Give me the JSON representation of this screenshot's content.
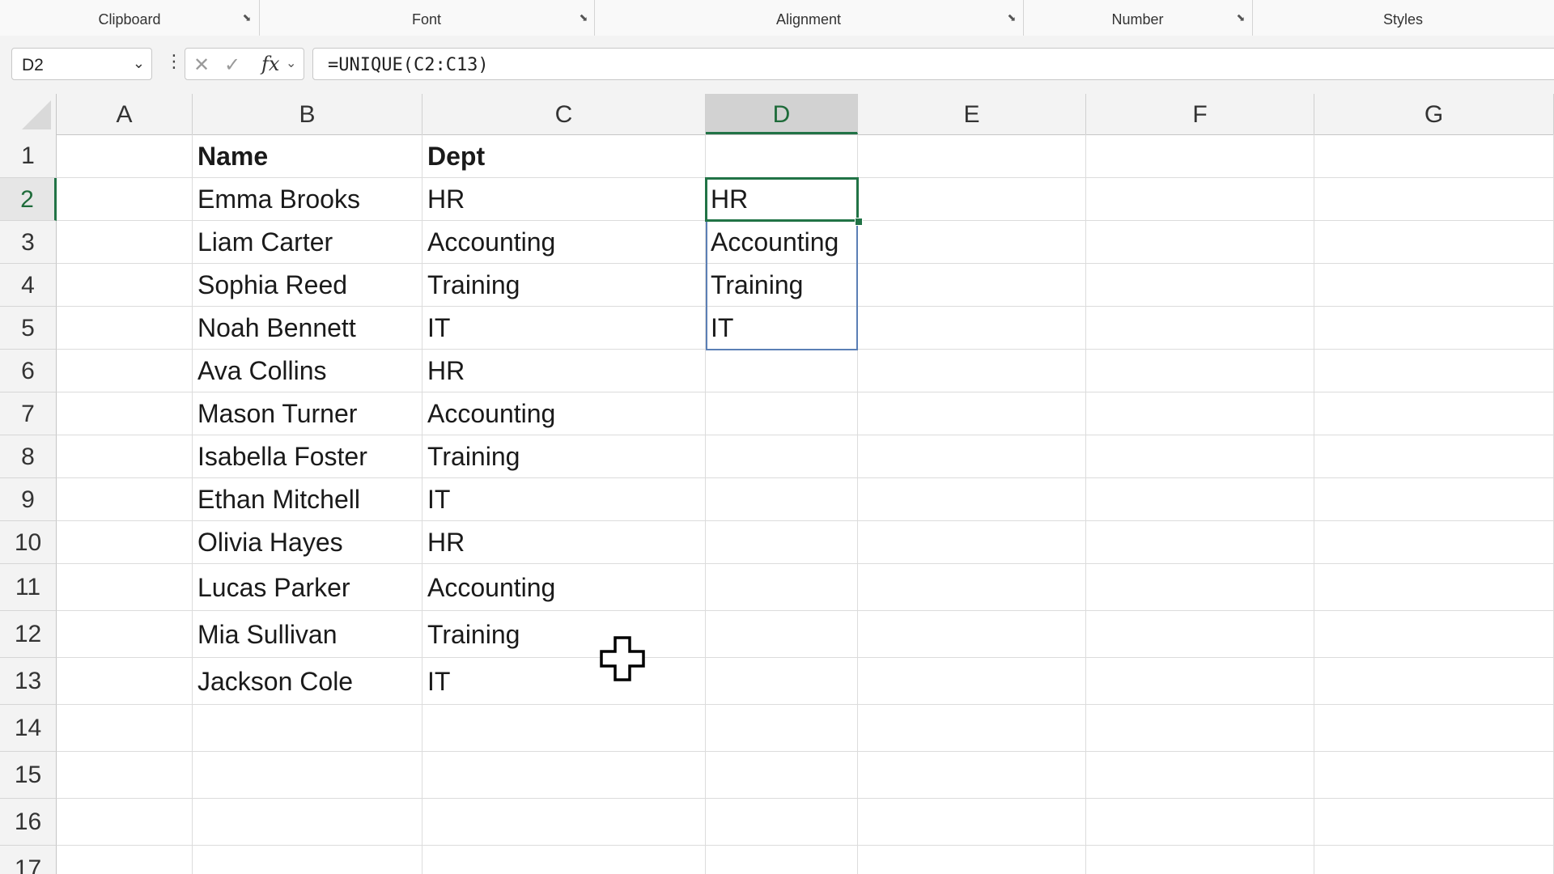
{
  "ribbon": {
    "groups": [
      {
        "label": "Clipboard",
        "has_launcher": true
      },
      {
        "label": "Font",
        "has_launcher": true
      },
      {
        "label": "Alignment",
        "has_launcher": true
      },
      {
        "label": "Number",
        "has_launcher": true
      },
      {
        "label": "Styles",
        "has_launcher": false
      }
    ]
  },
  "formula_bar": {
    "name_box": "D2",
    "formula": "=UNIQUE(C2:C13)",
    "fx_label": "fx"
  },
  "sheet": {
    "columns": [
      "A",
      "B",
      "C",
      "D",
      "E",
      "F",
      "G"
    ],
    "active_column": "D",
    "active_row": "2",
    "rows": [
      {
        "num": "1",
        "B": "Name",
        "C": "Dept",
        "D": ""
      },
      {
        "num": "2",
        "B": "Emma Brooks",
        "C": "HR",
        "D": "HR"
      },
      {
        "num": "3",
        "B": "Liam Carter",
        "C": "Accounting",
        "D": "Accounting"
      },
      {
        "num": "4",
        "B": "Sophia Reed",
        "C": "Training",
        "D": "Training"
      },
      {
        "num": "5",
        "B": "Noah Bennett",
        "C": "IT",
        "D": "IT"
      },
      {
        "num": "6",
        "B": "Ava Collins",
        "C": "HR",
        "D": ""
      },
      {
        "num": "7",
        "B": "Mason Turner",
        "C": "Accounting",
        "D": ""
      },
      {
        "num": "8",
        "B": "Isabella Foster",
        "C": "Training",
        "D": ""
      },
      {
        "num": "9",
        "B": "Ethan Mitchell",
        "C": "IT",
        "D": ""
      },
      {
        "num": "10",
        "B": "Olivia Hayes",
        "C": "HR",
        "D": ""
      },
      {
        "num": "11",
        "B": "Lucas Parker",
        "C": "Accounting",
        "D": ""
      },
      {
        "num": "12",
        "B": "Mia Sullivan",
        "C": "Training",
        "D": ""
      },
      {
        "num": "13",
        "B": "Jackson Cole",
        "C": "IT",
        "D": ""
      },
      {
        "num": "14",
        "B": "",
        "C": "",
        "D": ""
      },
      {
        "num": "15",
        "B": "",
        "C": "",
        "D": ""
      },
      {
        "num": "16",
        "B": "",
        "C": "",
        "D": ""
      },
      {
        "num": "17",
        "B": "",
        "C": "",
        "D": ""
      }
    ]
  },
  "colors": {
    "accent": "#217346",
    "spill_border": "#5b7fb5"
  },
  "cursor": "cell-select-cross-icon"
}
